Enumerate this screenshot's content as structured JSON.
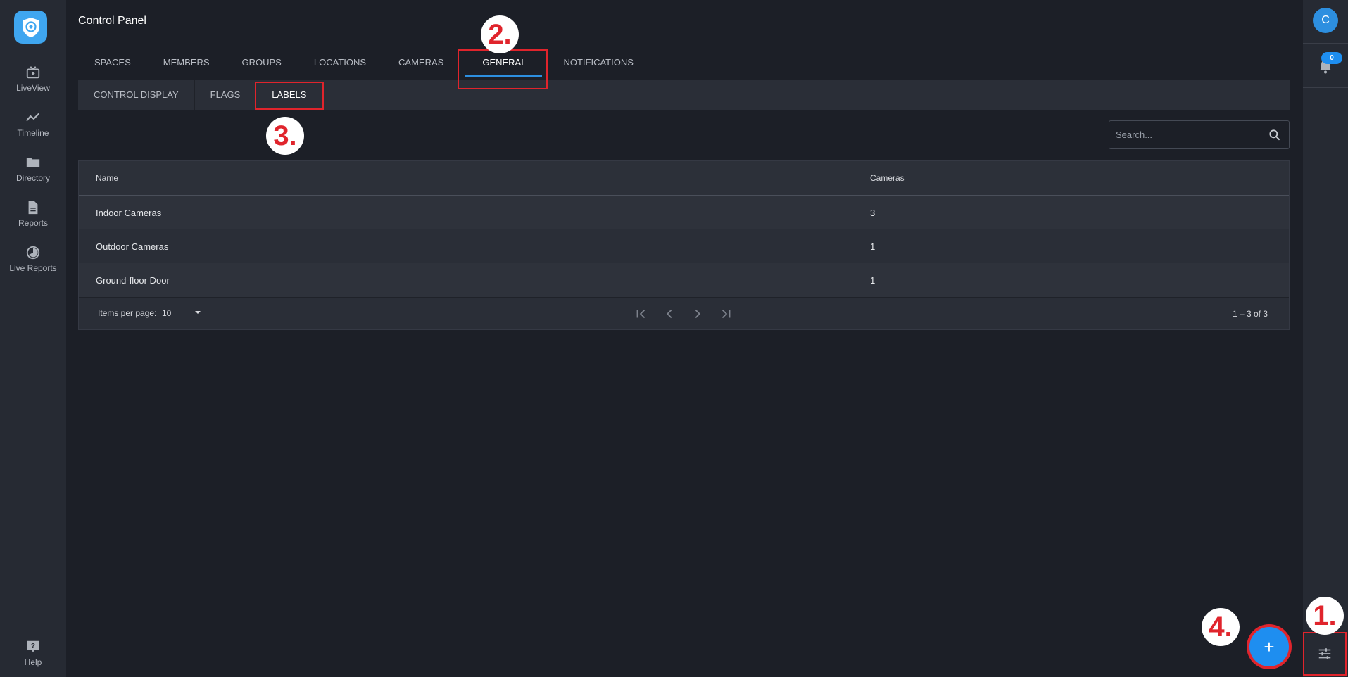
{
  "app": {
    "title": "Control Panel"
  },
  "sidebar": {
    "items": [
      {
        "label": "LiveView",
        "icon": "liveview-icon"
      },
      {
        "label": "Timeline",
        "icon": "timeline-icon"
      },
      {
        "label": "Directory",
        "icon": "folder-icon"
      },
      {
        "label": "Reports",
        "icon": "reports-icon"
      },
      {
        "label": "Live Reports",
        "icon": "live-reports-icon"
      }
    ],
    "help": {
      "label": "Help",
      "icon": "help-icon"
    }
  },
  "tabs": [
    "SPACES",
    "MEMBERS",
    "GROUPS",
    "LOCATIONS",
    "CAMERAS",
    "GENERAL",
    "NOTIFICATIONS"
  ],
  "active_tab": "GENERAL",
  "subtabs": [
    "CONTROL DISPLAY",
    "FLAGS",
    "LABELS"
  ],
  "active_subtab": "LABELS",
  "search": {
    "placeholder": "Search..."
  },
  "table": {
    "headers": {
      "name": "Name",
      "cameras": "Cameras"
    },
    "rows": [
      {
        "name": "Indoor Cameras",
        "cameras": "3"
      },
      {
        "name": "Outdoor Cameras",
        "cameras": "1"
      },
      {
        "name": "Ground-floor Door",
        "cameras": "1"
      }
    ]
  },
  "paginator": {
    "items_per_page_label": "Items per page:",
    "items_per_page": "10",
    "range": "1 – 3 of 3"
  },
  "user": {
    "avatar_initial": "C"
  },
  "notifications": {
    "count": "0"
  },
  "fab": {
    "label": "+"
  },
  "annotations": [
    "1.",
    "2.",
    "3.",
    "4."
  ],
  "colors": {
    "accent": "#1e8ef0",
    "annotation": "#e0242c",
    "sidebar": "#262a33",
    "background": "#1c1f27"
  }
}
